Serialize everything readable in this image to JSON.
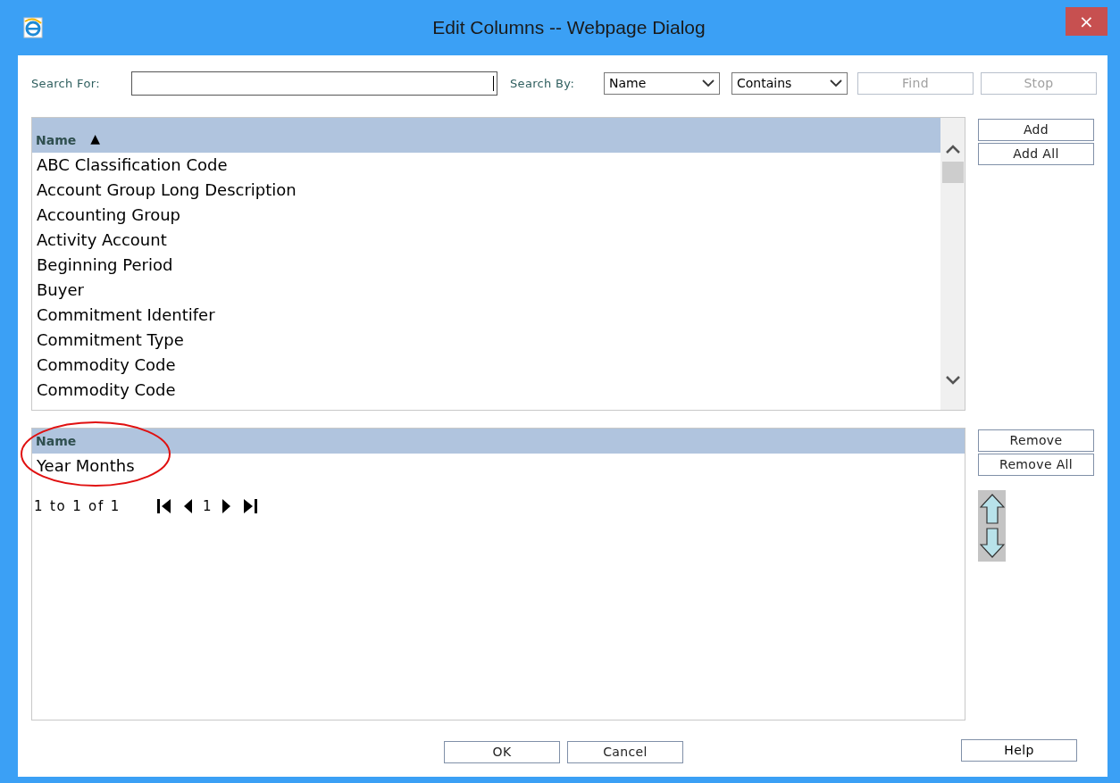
{
  "window": {
    "title": "Edit Columns -- Webpage Dialog",
    "close": "×"
  },
  "search": {
    "label": "Search For:",
    "by_label": "Search By:",
    "by": "Name",
    "match": "Contains"
  },
  "search_buttons": [
    {
      "label": "Find",
      "disabled": true
    },
    {
      "label": "Stop",
      "disabled": true
    }
  ],
  "available": {
    "header": "Name",
    "sort": "▲",
    "items": [
      "ABC Classification Code",
      "Account Group Long Description",
      "Accounting Group",
      "Activity Account",
      "Beginning Period",
      "Buyer",
      "Commitment Identifer",
      "Commitment Type",
      "Commodity Code",
      "Commodity Code"
    ]
  },
  "add_buttons": [
    "Add",
    "Add All"
  ],
  "selected": {
    "header": "Name",
    "items": [
      "Year Months"
    ],
    "pager": {
      "summary": "1 to 1 of 1",
      "page": "1"
    }
  },
  "remove_buttons": [
    "Remove",
    "Remove All"
  ],
  "footer_buttons": [
    "OK",
    "Cancel"
  ],
  "help": "Help"
}
